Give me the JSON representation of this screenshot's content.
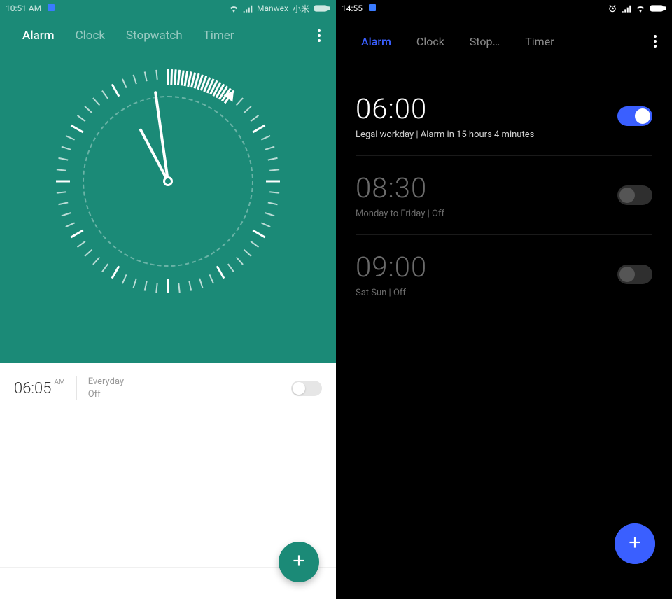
{
  "left": {
    "status": {
      "time": "10:51 AM",
      "carrier": "Manwex",
      "brand": "小米"
    },
    "tabs": [
      "Alarm",
      "Clock",
      "Stopwatch",
      "Timer"
    ],
    "active_tab_index": 0,
    "alarm": {
      "time": "06:05",
      "ampm": "AM",
      "repeat": "Everyday",
      "state": "Off",
      "enabled": false
    },
    "fab_icon": "plus-icon"
  },
  "right": {
    "status": {
      "time": "14:55"
    },
    "tabs": [
      "Alarm",
      "Clock",
      "Stop…",
      "Timer"
    ],
    "active_tab_index": 0,
    "alarms": [
      {
        "time": "06:00",
        "subtitle": "Legal workday  |  Alarm in 15 hours 4 minutes",
        "enabled": true
      },
      {
        "time": "08:30",
        "subtitle": "Monday to Friday  |  Off",
        "enabled": false
      },
      {
        "time": "09:00",
        "subtitle": "Sat Sun  |  Off",
        "enabled": false
      }
    ],
    "fabs": {
      "mic_icon": "mic-icon",
      "plus_icon": "plus-icon"
    }
  }
}
